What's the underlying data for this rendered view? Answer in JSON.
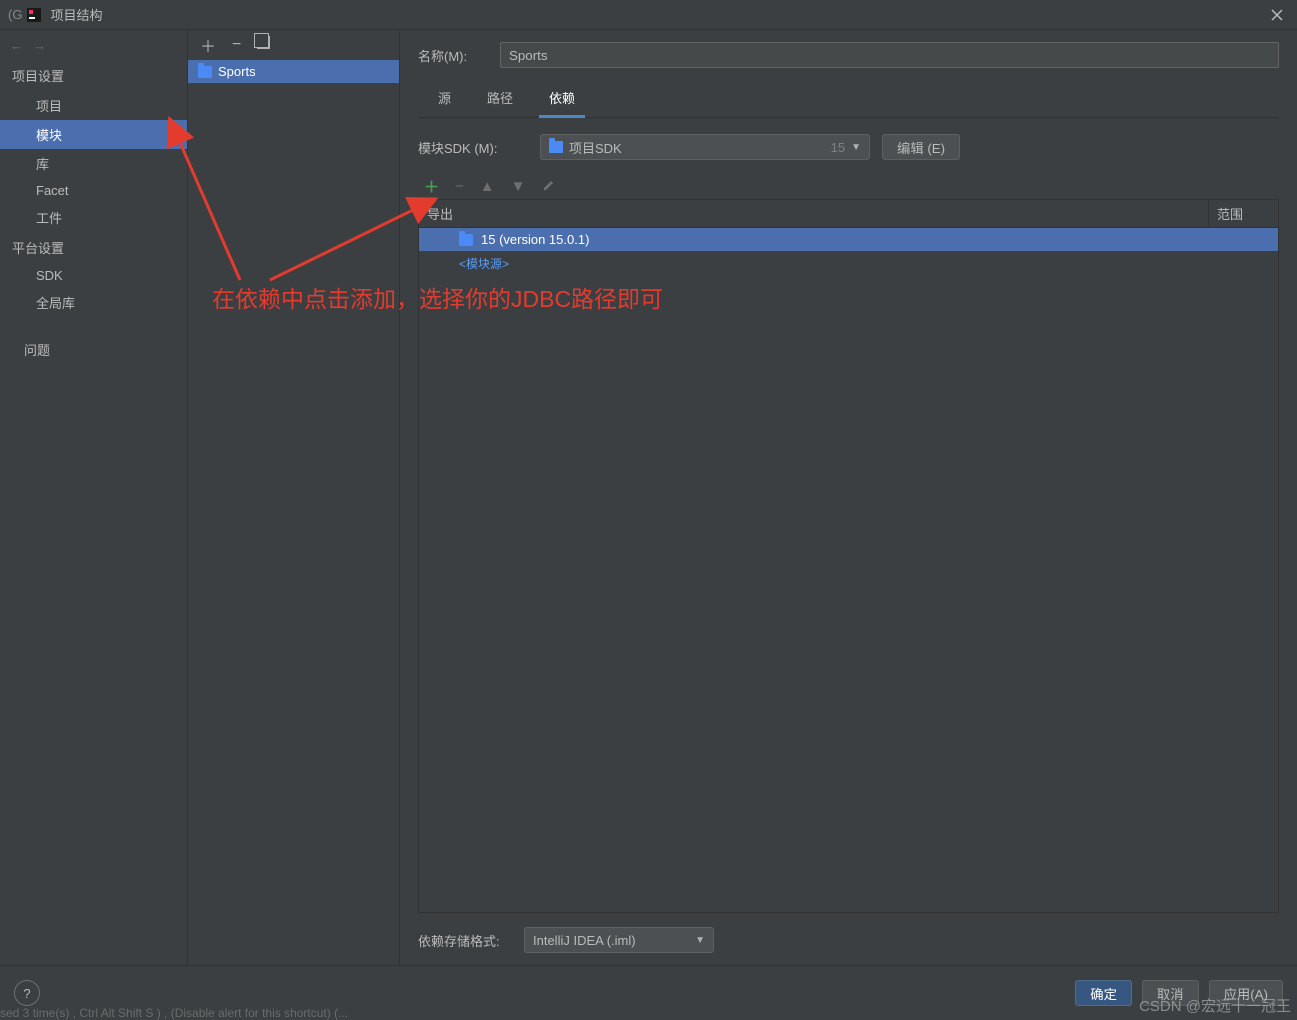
{
  "window": {
    "title": "项目结构",
    "prefix_char": "(G"
  },
  "sidebar": {
    "sections": [
      {
        "label": "项目设置",
        "items": [
          "项目",
          "模块",
          "库",
          "Facet",
          "工件"
        ]
      },
      {
        "label": "平台设置",
        "items": [
          "SDK",
          "全局库"
        ]
      },
      {
        "label_empty": "",
        "items": [
          "问题"
        ]
      }
    ],
    "selected": "模块"
  },
  "modules": {
    "list": [
      {
        "name": "Sports"
      }
    ]
  },
  "form": {
    "name_label": "名称(M):",
    "name_value": "Sports",
    "tabs": [
      "源",
      "路径",
      "依赖"
    ],
    "active_tab": "依赖",
    "module_sdk_label": "模块SDK (M):",
    "sdk_value": "项目SDK",
    "sdk_suffix": "15",
    "edit_button": "编辑 (E)",
    "dep_table": {
      "header_export": "导出",
      "header_scope": "范围",
      "rows": [
        {
          "text": "15 (version 15.0.1)",
          "selected": true
        }
      ],
      "module_source_link": "<模块源>"
    },
    "storage_label": "依赖存储格式:",
    "storage_value": "IntelliJ IDEA (.iml)"
  },
  "footer": {
    "ok": "确定",
    "cancel": "取消",
    "apply": "应用(A)"
  },
  "annotation": {
    "text": "在依赖中点击添加，选择你的JDBC路径即可"
  },
  "watermark": "CSDN @宏远十一冠王",
  "edge_text": "sed 3 time(s) ,  Ctrl  Alt  Shift  S ) , (Disable alert for this shortcut) (..."
}
